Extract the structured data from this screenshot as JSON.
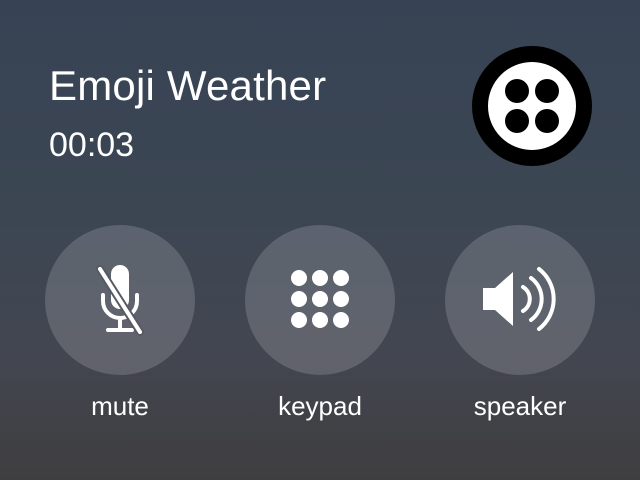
{
  "call": {
    "caller_name": "Emoji Weather",
    "duration": "00:03"
  },
  "avatar": {
    "icon": "four-dots-logo-icon"
  },
  "controls": [
    {
      "id": "mute",
      "label": "mute",
      "icon": "microphone-muted-icon"
    },
    {
      "id": "keypad",
      "label": "keypad",
      "icon": "keypad-grid-icon"
    },
    {
      "id": "speaker",
      "label": "speaker",
      "icon": "speaker-volume-icon"
    }
  ],
  "colors": {
    "text": "#ffffff",
    "button_fill": "rgba(255,255,255,0.16)",
    "avatar_ring": "#000000"
  }
}
